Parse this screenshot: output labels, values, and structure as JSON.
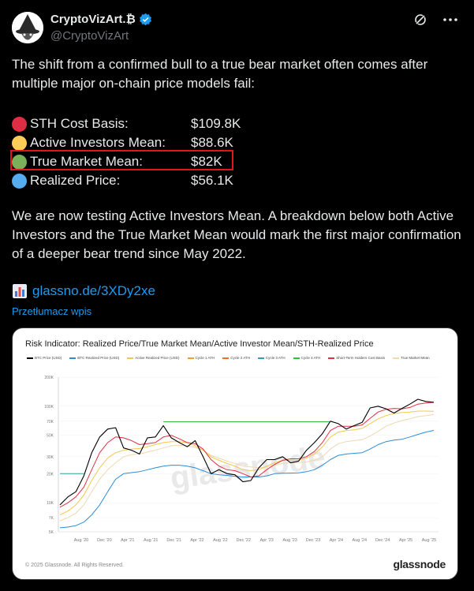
{
  "author": {
    "name": "CryptoVizArt.₿",
    "handle": "@CryptoVizArt"
  },
  "tweet": {
    "intro": "The shift from a confirmed bull to a true bear market often comes after multiple major on-chain price models fail:",
    "models": [
      {
        "label": "STH Cost Basis:",
        "value": "$109.8K",
        "color": "#dd2e44"
      },
      {
        "label": "Active Investors Mean:",
        "value": "$88.6K",
        "color": "#fdcb58"
      },
      {
        "label": "True Market Mean:",
        "value": "$82K",
        "color": "#78b159",
        "highlighted": true
      },
      {
        "label": "Realized Price:",
        "value": "$56.1K",
        "color": "#55acee"
      }
    ],
    "para2": "We are now testing Active Investors Mean. A breakdown below both Active Investors and the True Market Mean would mark the first major confirmation of a deeper bear trend since May 2022.",
    "link": "glassno.de/3XDy2xe",
    "link_icon": "bar-chart-icon",
    "translate": "Przetłumacz wpis"
  },
  "chart_data": {
    "type": "line",
    "title": "Risk Indicator: Realized Price/True Market Mean/Active Investor Mean/STH-Realized Price",
    "legend": [
      {
        "name": "BTC Price (USD)",
        "color": "#000000"
      },
      {
        "name": "BTC Realized Price (USD)",
        "color": "#2c8cd6"
      },
      {
        "name": "Active Realized Price (USD)",
        "color": "#f0c850"
      },
      {
        "name": "Cycle 1 ATH",
        "color": "#f0a020"
      },
      {
        "name": "Cycle 2 ATH",
        "color": "#f07020"
      },
      {
        "name": "Cycle 3 ATH",
        "color": "#30a0a0"
      },
      {
        "name": "Cycle 4 ATH",
        "color": "#30c040"
      },
      {
        "name": "Short-Term Holders Cost Basis",
        "color": "#e03040"
      },
      {
        "name": "True Market Mean",
        "color": "#f0d8b0"
      }
    ],
    "y_ticks": [
      "200K",
      "100K",
      "70K",
      "50K",
      "30K",
      "20K",
      "10K",
      "7K",
      "5K"
    ],
    "x_ticks": [
      "Aug '20",
      "Dec '20",
      "Apr '21",
      "Aug '21",
      "Dec '21",
      "Apr '22",
      "Aug '22",
      "Dec '22",
      "Apr '23",
      "Aug '23",
      "Dec '23",
      "Apr '24",
      "Aug '24",
      "Dec '24",
      "Apr '25",
      "Aug '25"
    ],
    "y_scale": "log",
    "ylim": [
      5000,
      200000
    ],
    "watermark": "glassnode",
    "series": [
      {
        "name": "BTC Price (USD)",
        "values": [
          9500,
          11500,
          13000,
          19000,
          33000,
          48000,
          58000,
          60000,
          37000,
          35000,
          32000,
          47000,
          48000,
          63000,
          47000,
          42000,
          38000,
          44000,
          30000,
          20000,
          22000,
          20000,
          19500,
          16500,
          17000,
          23000,
          28000,
          28000,
          30000,
          26000,
          27000,
          35000,
          42000,
          52000,
          70000,
          66000,
          58000,
          63000,
          68000,
          96000,
          100000,
          94000,
          85000,
          95000,
          105000,
          118000,
          112000,
          110000
        ]
      },
      {
        "name": "True Market Mean",
        "values": [
          6500,
          7000,
          7800,
          9500,
          13000,
          17500,
          22000,
          26000,
          30000,
          31500,
          32000,
          33500,
          35000,
          37000,
          39000,
          39500,
          39000,
          37500,
          35000,
          31000,
          29000,
          27000,
          25500,
          24000,
          23500,
          23000,
          23500,
          24500,
          25500,
          26000,
          26000,
          26500,
          27500,
          30000,
          36000,
          41000,
          43000,
          44000,
          45000,
          49000,
          55000,
          62000,
          67000,
          71000,
          74000,
          78000,
          80000,
          82000
        ]
      },
      {
        "name": "Active Realized Price (USD)",
        "values": [
          7500,
          8200,
          9500,
          12000,
          17000,
          23000,
          29000,
          33000,
          35000,
          36000,
          36500,
          38000,
          40000,
          42000,
          43000,
          43000,
          42000,
          39000,
          35000,
          30000,
          27500,
          25500,
          24000,
          22000,
          21500,
          22000,
          24000,
          26000,
          27500,
          27500,
          27500,
          29000,
          32000,
          38000,
          48000,
          54000,
          56000,
          57000,
          59000,
          66000,
          74000,
          80000,
          84000,
          86000,
          87000,
          89000,
          89000,
          88600
        ]
      },
      {
        "name": "Short-Term Holders Cost Basis",
        "values": [
          9000,
          10000,
          11500,
          14500,
          22000,
          33000,
          42000,
          48000,
          47000,
          44000,
          40000,
          41000,
          42000,
          48000,
          50000,
          46000,
          42000,
          41000,
          36000,
          28000,
          24000,
          22000,
          21500,
          20000,
          18500,
          19000,
          22000,
          25000,
          27500,
          28500,
          28500,
          30000,
          34000,
          42000,
          56000,
          62000,
          62000,
          62000,
          64000,
          75000,
          87000,
          93000,
          95000,
          94000,
          97000,
          105000,
          108000,
          109800
        ]
      },
      {
        "name": "BTC Realized Price (USD)",
        "values": [
          5500,
          5600,
          5800,
          6300,
          7500,
          9500,
          13000,
          17500,
          20000,
          20500,
          21000,
          22000,
          23000,
          24000,
          24500,
          24500,
          24000,
          23000,
          21500,
          20000,
          19500,
          19200,
          18800,
          18500,
          18500,
          18500,
          19000,
          20000,
          20200,
          20300,
          20400,
          21000,
          22000,
          24500,
          28000,
          31000,
          32000,
          32500,
          33000,
          36000,
          40000,
          43000,
          44500,
          45500,
          48000,
          51000,
          54000,
          56100
        ]
      },
      {
        "name": "Cycle 4 ATH",
        "values": [
          null,
          null,
          null,
          null,
          null,
          null,
          null,
          null,
          null,
          null,
          null,
          null,
          null,
          69000,
          69000,
          69000,
          69000,
          69000,
          69000,
          69000,
          69000,
          69000,
          69000,
          69000,
          69000,
          69000,
          69000,
          69000,
          69000,
          69000,
          69000,
          69000,
          69000,
          69000,
          69000
        ]
      },
      {
        "name": "Cycle 3 ATH",
        "values": [
          20000,
          20000,
          20000,
          20000
        ]
      }
    ]
  },
  "card": {
    "copyright": "© 2025 Glassnode. All Rights Reserved.",
    "logo": "glassnode"
  }
}
